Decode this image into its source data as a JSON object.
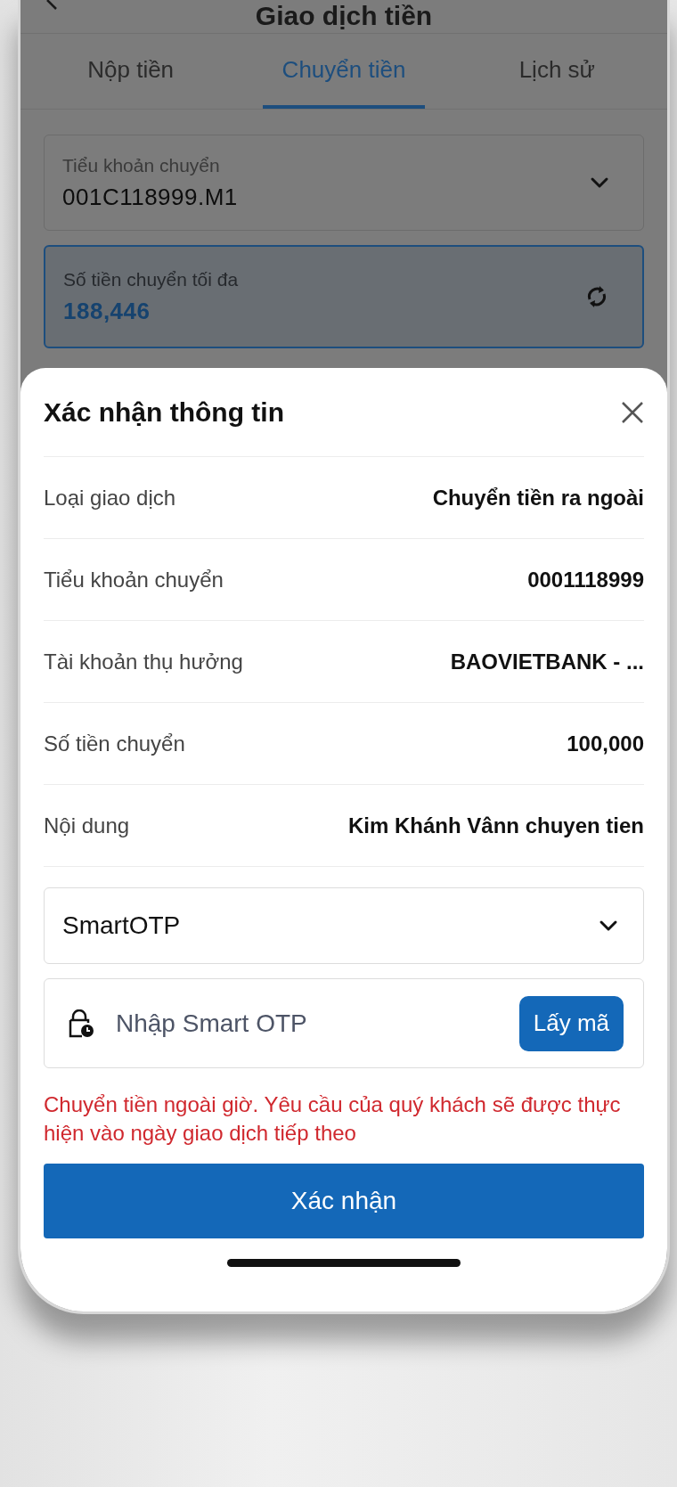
{
  "header": {
    "title": "Giao dịch tiền"
  },
  "tabs": [
    {
      "label": "Nộp tiền",
      "selected": false
    },
    {
      "label": "Chuyển tiền",
      "selected": true
    },
    {
      "label": "Lịch sử",
      "selected": false
    }
  ],
  "fields": [
    {
      "kind": "dropdown",
      "label": "Tiểu khoản chuyển",
      "value": "001C118999.M1",
      "focused": false
    },
    {
      "kind": "refresh",
      "label": "Số tiền chuyển tối đa",
      "value": "188,446",
      "focused": true
    }
  ],
  "sheet": {
    "title": "Xác nhận thông tin",
    "rows": [
      {
        "label": "Loại giao dịch",
        "value": "Chuyển tiền ra ngoài"
      },
      {
        "label": "Tiểu khoản chuyển",
        "value": "0001118999"
      },
      {
        "label": "Tài khoản thụ hưởng",
        "value": "BAOVIETBANK - ..."
      },
      {
        "label": "Số tiền chuyển",
        "value": "100,000"
      },
      {
        "label": "Nội dung",
        "value": "Kim Khánh Vânn chuyen tien"
      }
    ],
    "method_select": {
      "value": "SmartOTP"
    },
    "otp_field": {
      "placeholder": "Nhập Smart OTP",
      "button": "Lấy mã"
    },
    "warning": "Chuyển tiền ngoài giờ. Yêu cầu của quý khách sẽ được thực hiện vào ngày giao dịch tiếp theo",
    "confirm_button": "Xác nhận"
  }
}
